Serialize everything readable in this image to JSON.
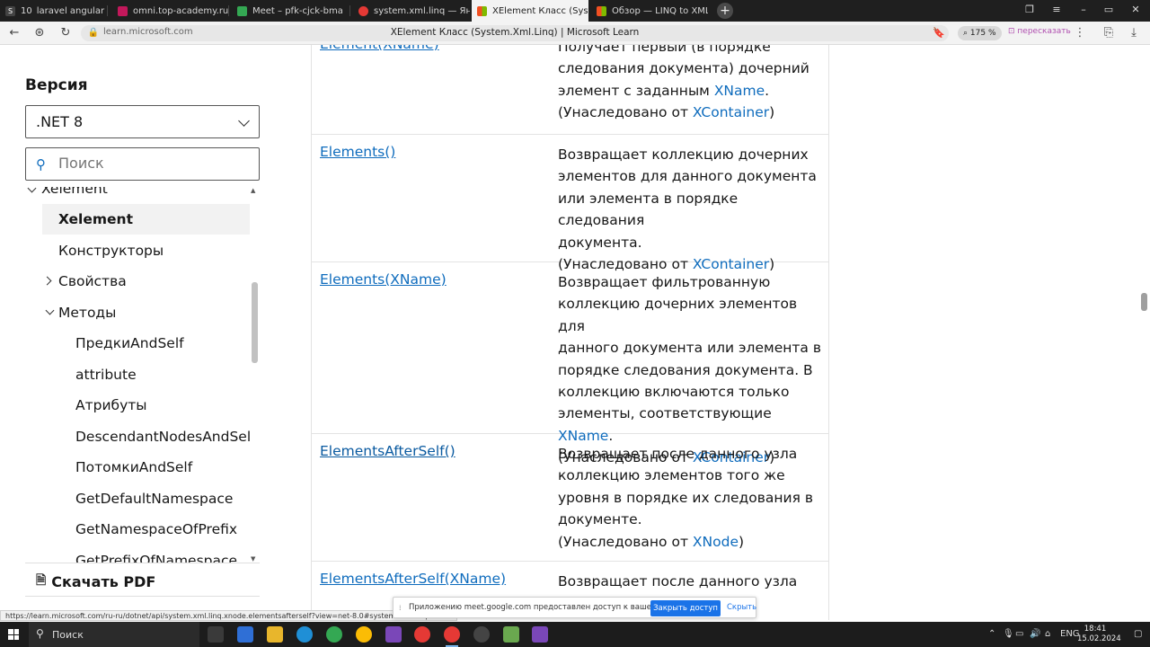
{
  "browser": {
    "tabs": [
      {
        "label": "laravel angular",
        "badge": "10"
      },
      {
        "label": "omni.top-academy.ru/#/p"
      },
      {
        "label": "Meet – pfk-cjck-bma"
      },
      {
        "label": "system.xml.linq — Яндекс"
      },
      {
        "label": "XElement Класс (System"
      },
      {
        "label": "Обзор — LINQ to XML -"
      }
    ],
    "url": "learn.microsoft.com",
    "page_title": "XElement Класс (System.Xml.Linq) | Microsoft Learn",
    "zoom": "175 %",
    "retell_label": "пересказать",
    "status_url": "https://learn.microsoft.com/ru-ru/dotnet/api/system.xml.linq.xnode.elementsafterself?view=net-8.0#system-xml-linq-xnode"
  },
  "sidebar": {
    "version_label": "Версия",
    "version_value": ".NET 8",
    "search_placeholder": "Поиск",
    "toc": [
      {
        "label": "Xelement",
        "indent": 0
      },
      {
        "label": "Xelement",
        "selected": true
      },
      {
        "label": "Конструкторы"
      },
      {
        "label": "Свойства"
      },
      {
        "label": "Методы"
      },
      {
        "label": "ПредкиAndSelf"
      },
      {
        "label": "attribute"
      },
      {
        "label": "Атрибуты"
      },
      {
        "label": "DescendantNodesAndSelf"
      },
      {
        "label": "ПотомкиAndSelf"
      },
      {
        "label": "GetDefaultNamespace"
      },
      {
        "label": "GetNamespaceOfPrefix"
      },
      {
        "label": "GetPrefixOfNamespace"
      }
    ],
    "download_pdf": "Скачать PDF"
  },
  "methods": [
    {
      "name": "Element(XName)",
      "desc": [
        "Получает первый (в порядке",
        "следования документа) дочерний",
        "элемент с заданным ",
        {
          "link": "XName"
        },
        ".",
        "(Унаследовано от ",
        {
          "link": "XContainer"
        },
        ")"
      ]
    },
    {
      "name": "Elements()",
      "desc_lines": [
        "Возвращает коллекцию дочерних",
        "элементов для данного документа",
        "или элемента в порядке следования",
        "документа."
      ],
      "inherited_prefix": "(Унаследовано от ",
      "inherited_link": "XContainer",
      "inherited_suffix": ")"
    },
    {
      "name": "Elements(XName)",
      "desc_lines": [
        "Возвращает фильтрованную",
        "коллекцию дочерних элементов для",
        "данного документа или элемента в",
        "порядке следования документа. В",
        "коллекцию включаются только"
      ],
      "tail_text": "элементы, соответствующие ",
      "tail_link": "XName",
      "tail_end": ".",
      "inherited_prefix": "(Унаследовано от ",
      "inherited_link": "XContainer",
      "inherited_suffix": ")"
    },
    {
      "name": "ElementsAfterSelf()",
      "desc_lines": [
        "Возвращает после данного узла",
        "коллекцию элементов того же",
        "уровня в порядке их следования в",
        "документе."
      ],
      "inherited_prefix": "(Унаследовано от ",
      "inherited_link": "XNode",
      "inherited_suffix": ")"
    },
    {
      "name": "ElementsAfterSelf(XName)",
      "desc_lines": [
        "Возвращает после данного узла"
      ]
    }
  ],
  "meet_bar": {
    "message": "Приложению meet.google.com предоставлен доступ к вашему экрану.",
    "stop_label": "Закрыть доступ",
    "hide_label": "Скрыть"
  },
  "taskbar": {
    "search_label": "Поиск",
    "lang": "ENG",
    "time": "18:41",
    "date": "15.02.2024"
  },
  "colors": {
    "link": "#0f6cbd",
    "share_button": "#1a73e8"
  }
}
